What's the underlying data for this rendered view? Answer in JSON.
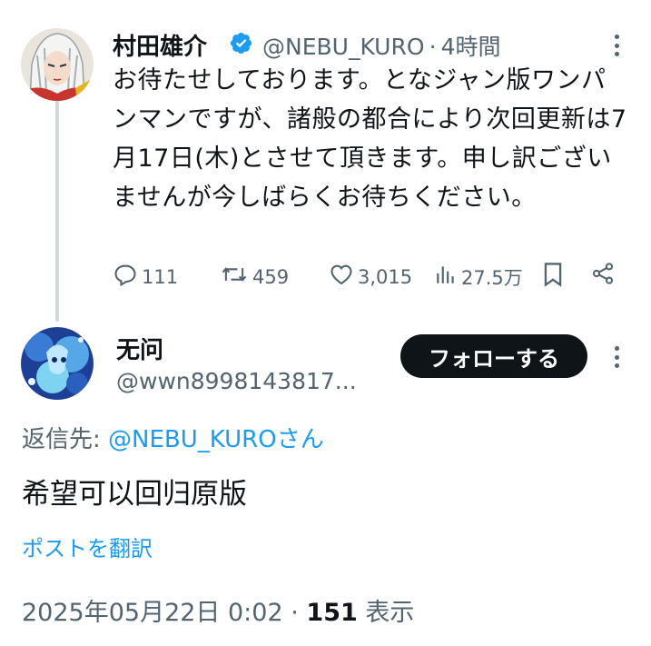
{
  "parent_tweet": {
    "author_name": "村田雄介",
    "handle": "@NEBU_KURO",
    "separator": "·",
    "time": "4時間",
    "text": "お待たせしております。となジャン版ワンパンマンですが、諸般の都合により次回更新は7月17日(木)とさせて頂きます。申し訳ございませんが今しばらくお待ちください。",
    "actions": {
      "replies": "111",
      "reposts": "459",
      "likes": "3,015",
      "views": "27.5万"
    }
  },
  "reply_tweet": {
    "author_name": "无问",
    "handle": "@wwn8998143817...",
    "follow_label": "フォローする",
    "reply_to_prefix": "返信先: ",
    "reply_to_handle": "@NEBU_KURO",
    "reply_to_suffix": "さん",
    "text": "希望可以回归原版",
    "translate_label": "ポストを翻訳",
    "date": "2025年05月22日 0:02",
    "separator": "·",
    "view_count": "151",
    "view_label": "表示"
  },
  "colors": {
    "text": "#0f1419",
    "secondary": "#536471",
    "link": "#1d9bf0",
    "verified": "#1d9bf0",
    "thread_line": "#cfd9de"
  },
  "icons": [
    "verified-badge-icon",
    "more-icon",
    "reply-icon",
    "repost-icon",
    "like-icon",
    "views-icon",
    "bookmark-icon",
    "share-icon"
  ]
}
